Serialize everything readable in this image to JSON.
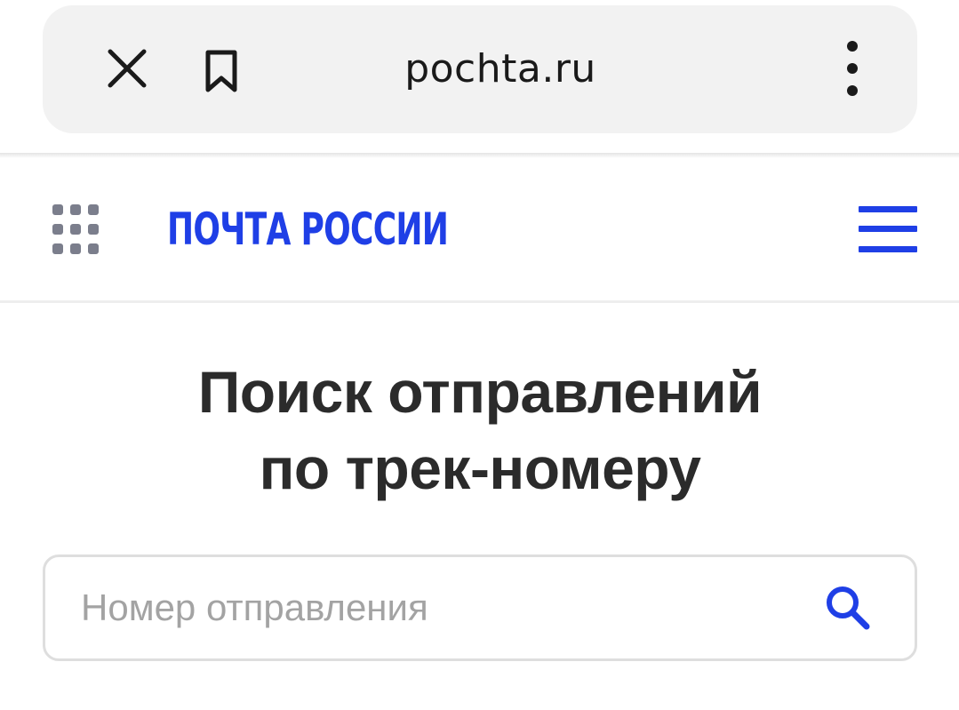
{
  "browser": {
    "url": "pochta.ru",
    "icons": {
      "close": "close-icon",
      "bookmark": "bookmark-icon",
      "more": "more-vertical-icon"
    }
  },
  "header": {
    "logo_text": "ПОЧТА РОССИИ",
    "icons": {
      "apps": "apps-grid-icon",
      "menu": "hamburger-menu-icon"
    }
  },
  "main": {
    "title_line1": "Поиск отправлений",
    "title_line2": "по трек-номеру",
    "search": {
      "placeholder": "Номер отправления",
      "value": "",
      "icon": "search-icon"
    }
  },
  "colors": {
    "brand": "#1f3fe6",
    "title": "#2b2b2b",
    "placeholder": "#a3a3a3",
    "browser_bar": "#f2f2f2",
    "grid_dots": "#7b7e8c"
  }
}
